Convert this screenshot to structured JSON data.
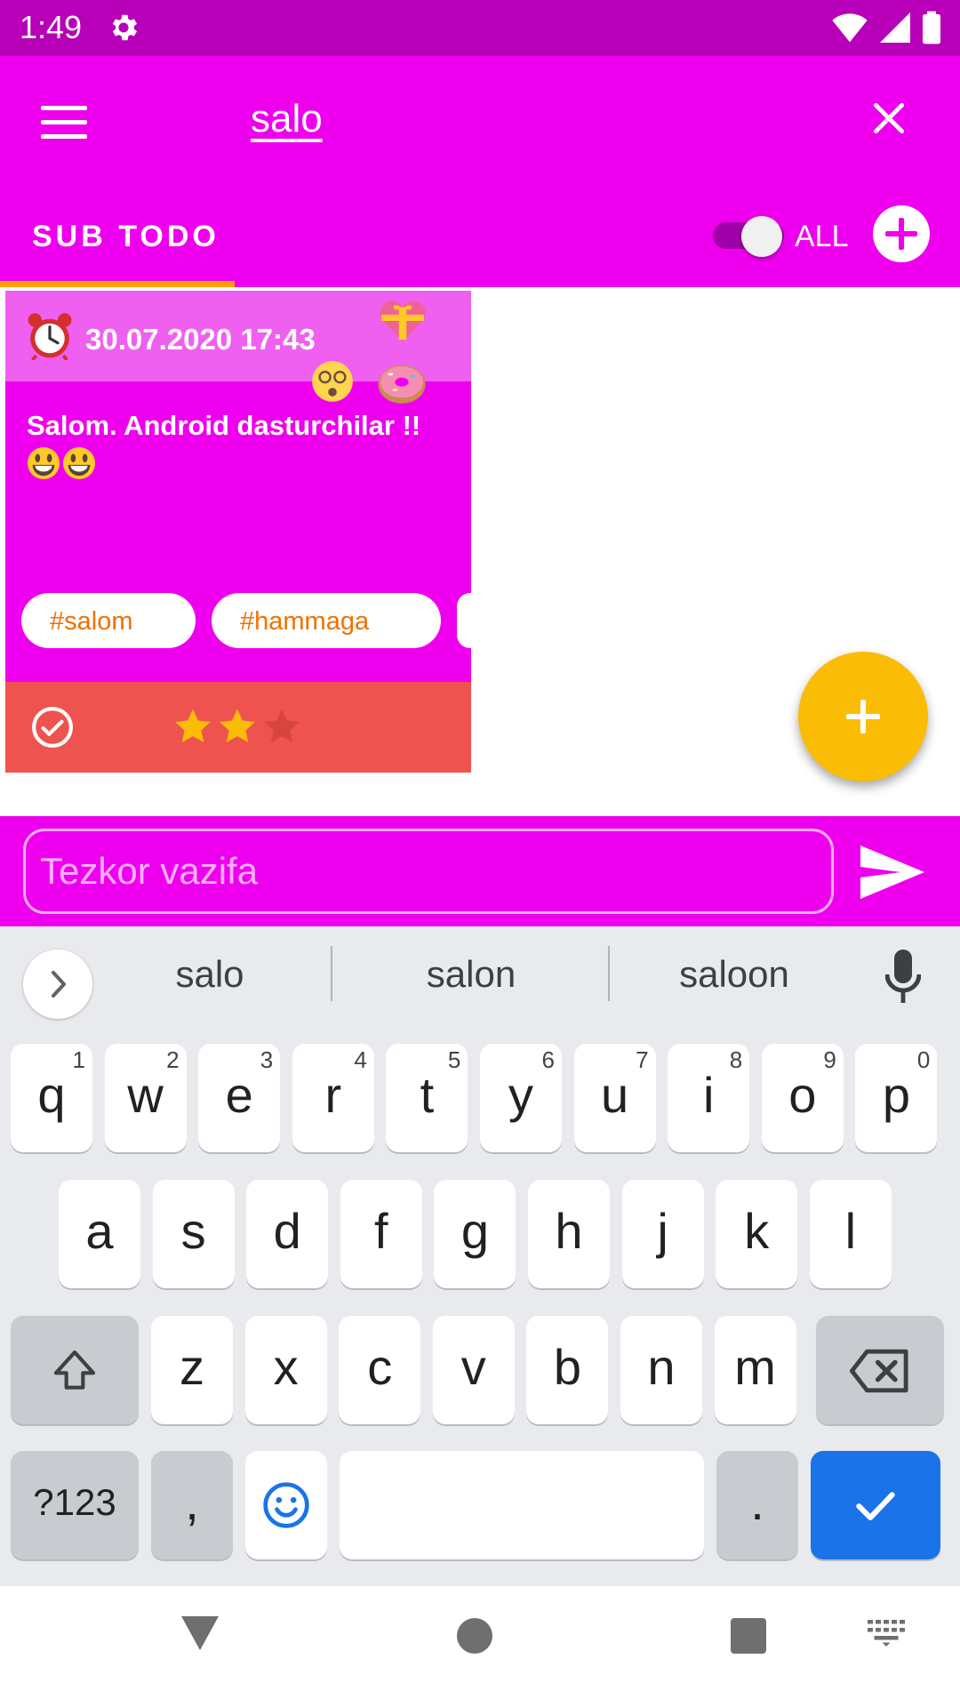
{
  "status_bar": {
    "time": "1:49"
  },
  "app_bar": {
    "search_query": "salo",
    "tab_label": "SUB TODO",
    "toggle_label": "ALL"
  },
  "card": {
    "datetime": "30.07.2020 17:43",
    "text": "Salom. Android dasturchilar !!",
    "tags": [
      "#salom",
      "#hammaga"
    ],
    "rating": 2,
    "rating_max": 3
  },
  "quick_input": {
    "placeholder": "Tezkor vazifa"
  },
  "keyboard": {
    "suggestions": [
      "salo",
      "salon",
      "saloon"
    ],
    "row1": [
      {
        "key": "q",
        "hint": "1"
      },
      {
        "key": "w",
        "hint": "2"
      },
      {
        "key": "e",
        "hint": "3"
      },
      {
        "key": "r",
        "hint": "4"
      },
      {
        "key": "t",
        "hint": "5"
      },
      {
        "key": "y",
        "hint": "6"
      },
      {
        "key": "u",
        "hint": "7"
      },
      {
        "key": "i",
        "hint": "8"
      },
      {
        "key": "o",
        "hint": "9"
      },
      {
        "key": "p",
        "hint": "0"
      }
    ],
    "row2": [
      "a",
      "s",
      "d",
      "f",
      "g",
      "h",
      "j",
      "k",
      "l"
    ],
    "row3": [
      "z",
      "x",
      "c",
      "v",
      "b",
      "n",
      "m"
    ],
    "symbols_label": "?123",
    "comma_label": ",",
    "period_label": "."
  },
  "colors": {
    "status_bar": "#b800b8",
    "primary": "#ee00ee",
    "card_header": "#f060f0",
    "card_footer": "#ef5350",
    "tab_indicator": "#ffa000",
    "fab": "#fbbc05",
    "tag_text": "#f07000",
    "keyboard_action": "#1a73e8"
  },
  "icons": {
    "status": [
      "gear-icon",
      "wifi-icon",
      "signal-icon",
      "battery-icon"
    ],
    "app_bar": [
      "menu-icon",
      "close-icon",
      "add-circle-icon"
    ],
    "card": [
      "alarm-clock-icon",
      "heart-gift-icon",
      "dizzy-face-icon",
      "donut-icon",
      "smiley-icon",
      "check-circle-icon",
      "star-icon"
    ],
    "keyboard": [
      "chevron-right-icon",
      "mic-icon",
      "shift-icon",
      "backspace-icon",
      "emoji-icon",
      "check-icon"
    ],
    "nav": [
      "back-triangle-icon",
      "home-circle-icon",
      "recents-square-icon",
      "keyboard-switch-icon"
    ]
  }
}
